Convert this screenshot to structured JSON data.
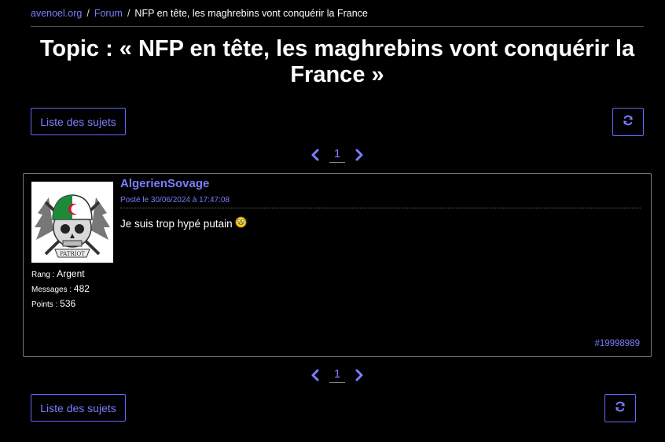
{
  "breadcrumb": {
    "site": "avenoel.org",
    "forum": "Forum",
    "current": "NFP en tête, les maghrebins vont conquérir la France",
    "sep": "/"
  },
  "topic": {
    "title": "Topic : « NFP en tête, les maghrebins vont conquérir la France »"
  },
  "buttons": {
    "list_label": "Liste des sujets",
    "refresh_icon": "refresh-icon"
  },
  "pagination": {
    "current_page": "1",
    "prev_icon": "chevron-left-icon",
    "next_icon": "chevron-right-icon"
  },
  "post": {
    "author": "AlgerienSovage",
    "date": "Posté le 30/06/2024 à 17:47:08",
    "content": "Je suis trop hypé putain",
    "emoji": "smiley-emoji-icon",
    "post_id": "#19998989",
    "avatar_text": "PATRIOT",
    "stats": {
      "rank_label": "Rang",
      "rank_value": "Argent",
      "messages_label": "Messages",
      "messages_value": "482",
      "points_label": "Points",
      "points_value": "536"
    }
  },
  "colors": {
    "accent": "#7b7dff",
    "background": "#000000",
    "text": "#ffffff",
    "border": "#777777"
  }
}
